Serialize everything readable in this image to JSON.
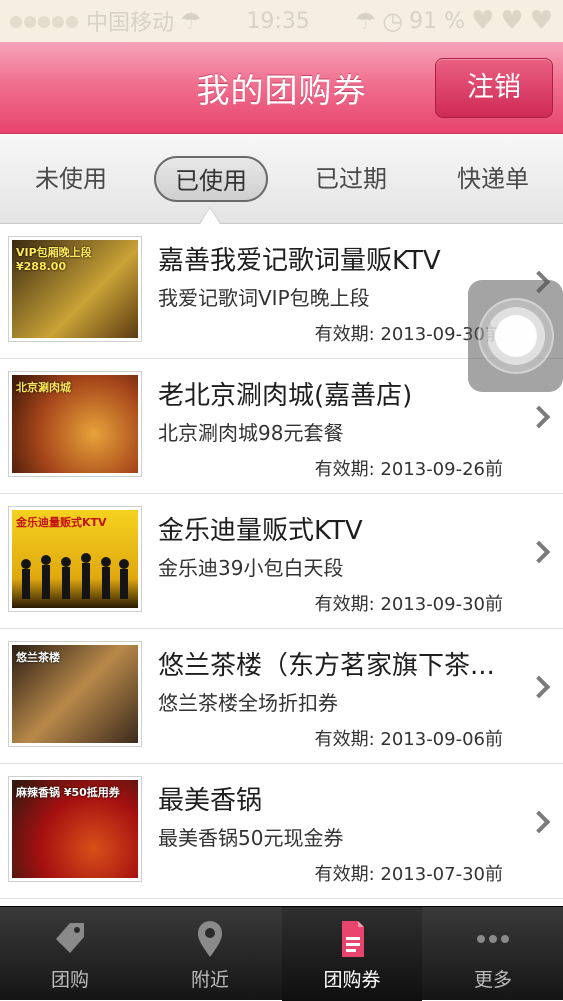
{
  "status_bar": {
    "carrier": "中国移动",
    "time": "19:35",
    "battery": "91 %"
  },
  "nav": {
    "title": "我的团购券",
    "logout_label": "注销"
  },
  "tabs": [
    {
      "label": "未使用",
      "active": false
    },
    {
      "label": "已使用",
      "active": true
    },
    {
      "label": "已过期",
      "active": false
    },
    {
      "label": "快递单",
      "active": false
    }
  ],
  "items": [
    {
      "title": "嘉善我爱记歌词量贩KTV",
      "subtitle": "我爱记歌词VIP包晚上段",
      "expiry": "有效期: 2013-09-30前",
      "thumb_text": "VIP包厢晚上段 ¥288.00",
      "thumb_colors": [
        "#3a2a12",
        "#c9a236"
      ]
    },
    {
      "title": "老北京涮肉城(嘉善店)",
      "subtitle": "北京涮肉城98元套餐",
      "expiry": "有效期: 2013-09-26前",
      "thumb_text": "北京涮肉城",
      "thumb_colors": [
        "#7a2a15",
        "#e8a33a"
      ]
    },
    {
      "title": "金乐迪量贩式KTV",
      "subtitle": "金乐迪39小包白天段",
      "expiry": "有效期: 2013-09-30前",
      "thumb_text": "金乐迪量贩式KTV",
      "thumb_colors": [
        "#f2c21b",
        "#1a1a1a"
      ]
    },
    {
      "title": "悠兰茶楼（东方茗家旗下茶...",
      "subtitle": "悠兰茶楼全场折扣券",
      "expiry": "有效期: 2013-09-06前",
      "thumb_text": "悠兰茶楼",
      "thumb_colors": [
        "#2a1d14",
        "#b8894a"
      ]
    },
    {
      "title": "最美香锅",
      "subtitle": "最美香锅50元现金券",
      "expiry": "有效期: 2013-07-30前",
      "thumb_text": "麻辣香锅 ¥50抵用券",
      "thumb_colors": [
        "#a51010",
        "#2a1a10"
      ]
    }
  ],
  "tabbar": [
    {
      "label": "团购",
      "icon": "tag-icon",
      "active": false
    },
    {
      "label": "附近",
      "icon": "location-pin-icon",
      "active": false
    },
    {
      "label": "团购券",
      "icon": "coupon-doc-icon",
      "active": true
    },
    {
      "label": "更多",
      "icon": "more-dots-icon",
      "active": false
    }
  ],
  "colors": {
    "nav_accent": "#e8446d",
    "active_tab_icon": "#e8446d"
  }
}
